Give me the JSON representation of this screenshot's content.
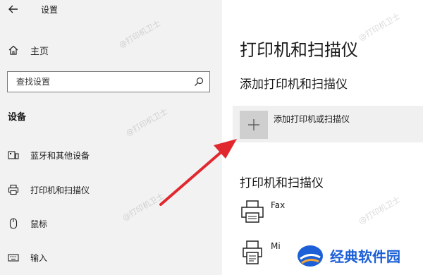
{
  "window": {
    "title": "设置"
  },
  "sidebar": {
    "home_label": "主页",
    "search_placeholder": "查找设置",
    "section_heading": "设备",
    "items": [
      {
        "label": "蓝牙和其他设备",
        "icon": "bluetooth-devices-icon"
      },
      {
        "label": "打印机和扫描仪",
        "icon": "printer-icon"
      },
      {
        "label": "鼠标",
        "icon": "mouse-icon"
      },
      {
        "label": "输入",
        "icon": "keyboard-icon"
      }
    ]
  },
  "main": {
    "title": "打印机和扫描仪",
    "add_section_title": "添加打印机和扫描仪",
    "add_button_label": "添加打印机或扫描仪",
    "list_section_title": "打印机和扫描仪",
    "printers": [
      {
        "name": "Fax",
        "icon": "fax-icon"
      },
      {
        "name": "Mi",
        "icon": "printer-doc-icon"
      }
    ]
  },
  "watermark": "@打印机卫士",
  "brand": {
    "name": "经典软件园"
  },
  "colors": {
    "arrow": "#e0282e",
    "brand": "#1c5fd6"
  }
}
